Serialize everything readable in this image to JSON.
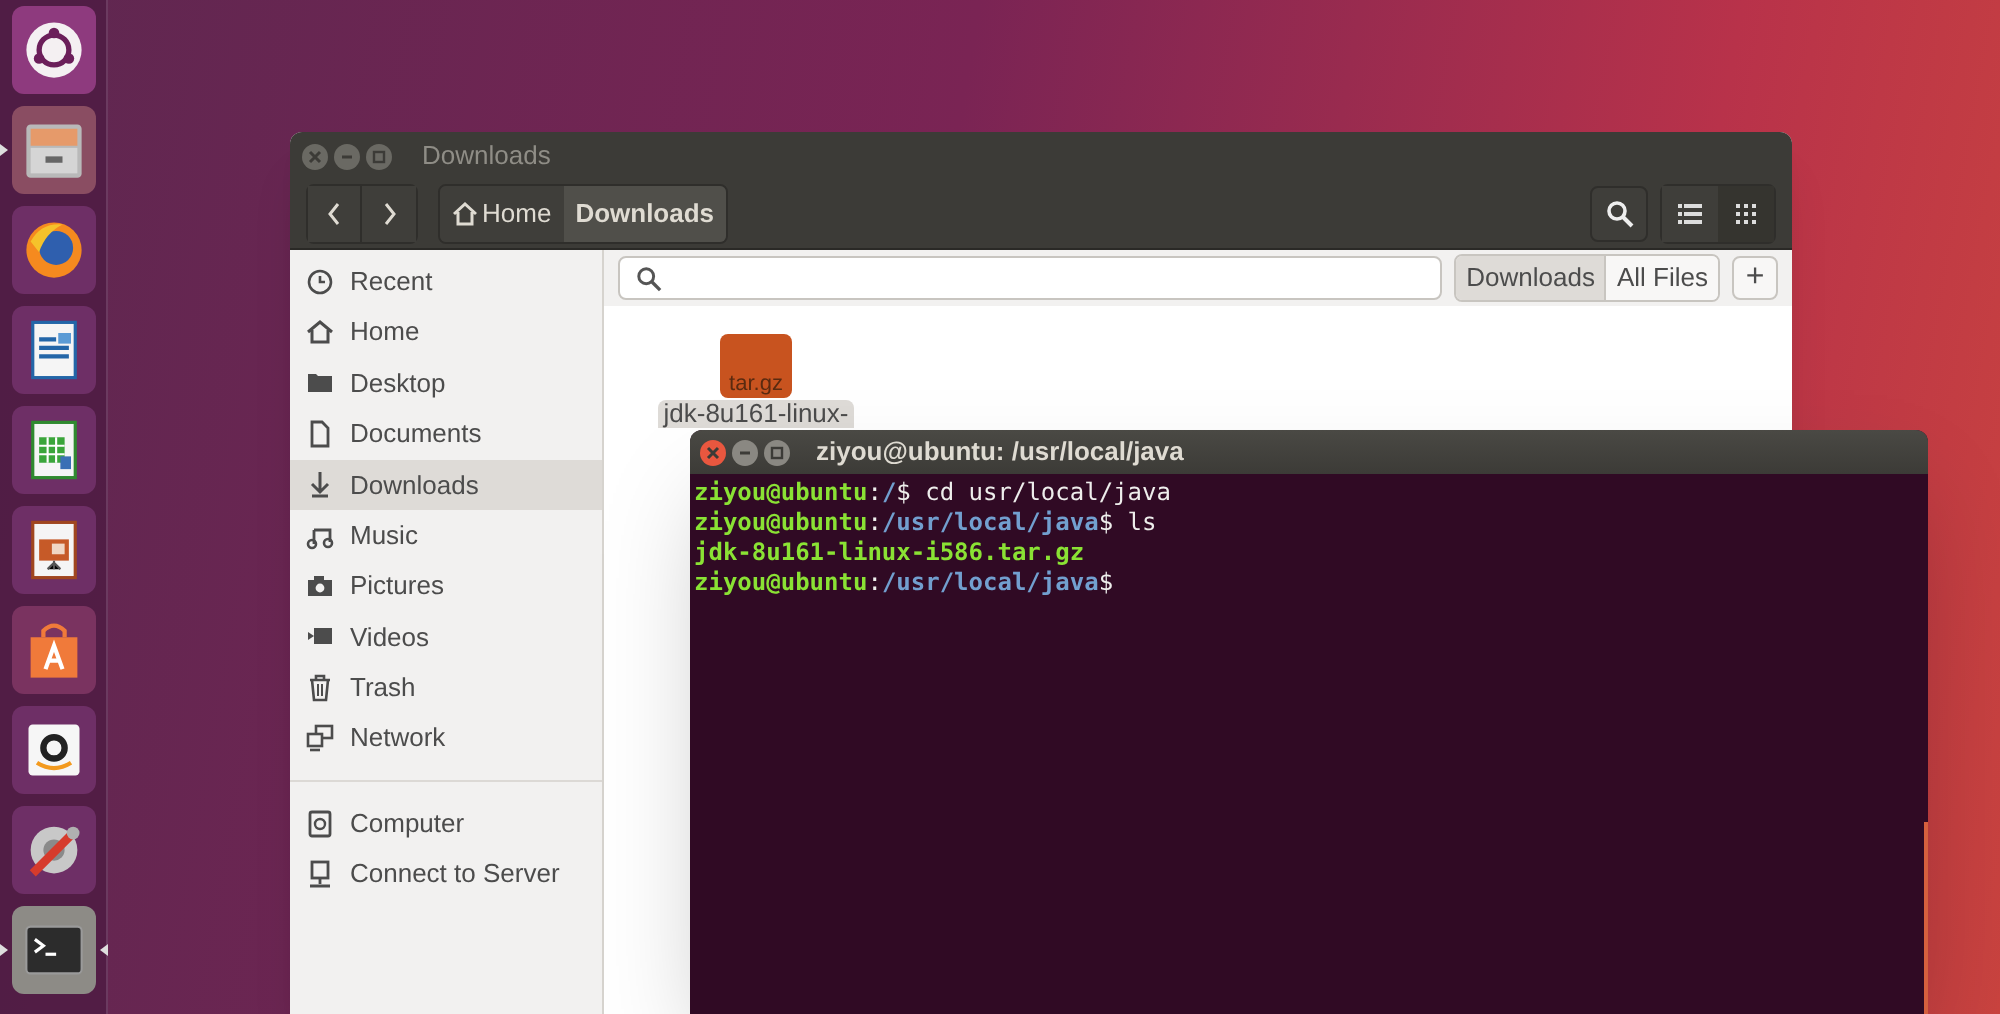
{
  "launcher": [
    {
      "kind": "dash",
      "running": false,
      "focused": false
    },
    {
      "kind": "files",
      "running": true,
      "focused": false
    },
    {
      "kind": "browser",
      "running": false,
      "focused": false
    },
    {
      "kind": "writer",
      "running": false,
      "focused": false
    },
    {
      "kind": "calc",
      "running": false,
      "focused": false
    },
    {
      "kind": "impress",
      "running": false,
      "focused": false
    },
    {
      "kind": "store",
      "running": false,
      "focused": false
    },
    {
      "kind": "amazon",
      "running": false,
      "focused": false
    },
    {
      "kind": "settings",
      "running": false,
      "focused": false
    },
    {
      "kind": "terminal",
      "running": true,
      "focused": true
    }
  ],
  "files_window": {
    "title": "Downloads",
    "breadcrumbs": [
      {
        "label": "Home",
        "kind": "home",
        "selected": false
      },
      {
        "label": "Downloads",
        "kind": "folder",
        "selected": true
      }
    ],
    "search_scope": [
      {
        "label": "Downloads",
        "selected": true
      },
      {
        "label": "All Files",
        "selected": false
      }
    ],
    "add_button": "+",
    "sidebar": [
      [
        {
          "label": "Recent",
          "kind": "clock",
          "selected": false
        },
        {
          "label": "Home",
          "kind": "home",
          "selected": false
        },
        {
          "label": "Desktop",
          "kind": "folder",
          "selected": false
        },
        {
          "label": "Documents",
          "kind": "document",
          "selected": false
        },
        {
          "label": "Downloads",
          "kind": "download",
          "selected": true
        },
        {
          "label": "Music",
          "kind": "music",
          "selected": false
        },
        {
          "label": "Pictures",
          "kind": "camera",
          "selected": false
        },
        {
          "label": "Videos",
          "kind": "video",
          "selected": false
        },
        {
          "label": "Trash",
          "kind": "trash",
          "selected": false
        },
        {
          "label": "Network",
          "kind": "network",
          "selected": false
        }
      ],
      [
        {
          "label": "Computer",
          "kind": "computer",
          "selected": false
        },
        {
          "label": "Connect to Server",
          "kind": "server",
          "selected": false
        }
      ]
    ],
    "files": [
      {
        "icon_label": "tar.gz",
        "name": "jdk-8u161-linux-",
        "selected": true
      }
    ]
  },
  "terminal": {
    "title": "ziyou@ubuntu: /usr/local/java",
    "lines": [
      [
        {
          "text": "ziyou@ubuntu",
          "kind": "user"
        },
        {
          "text": ":",
          "kind": "plain"
        },
        {
          "text": "/",
          "kind": "path"
        },
        {
          "text": "$ cd usr/local/java",
          "kind": "plain"
        }
      ],
      [
        {
          "text": "ziyou@ubuntu",
          "kind": "user"
        },
        {
          "text": ":",
          "kind": "plain"
        },
        {
          "text": "/usr/local/java",
          "kind": "path"
        },
        {
          "text": "$ ls",
          "kind": "plain"
        }
      ],
      [
        {
          "text": "jdk-8u161-linux-i586.tar.gz",
          "kind": "archive"
        }
      ],
      [
        {
          "text": "ziyou@ubuntu",
          "kind": "user"
        },
        {
          "text": ":",
          "kind": "plain"
        },
        {
          "text": "/usr/local/java",
          "kind": "path"
        },
        {
          "text": "$",
          "kind": "plain"
        }
      ]
    ]
  }
}
